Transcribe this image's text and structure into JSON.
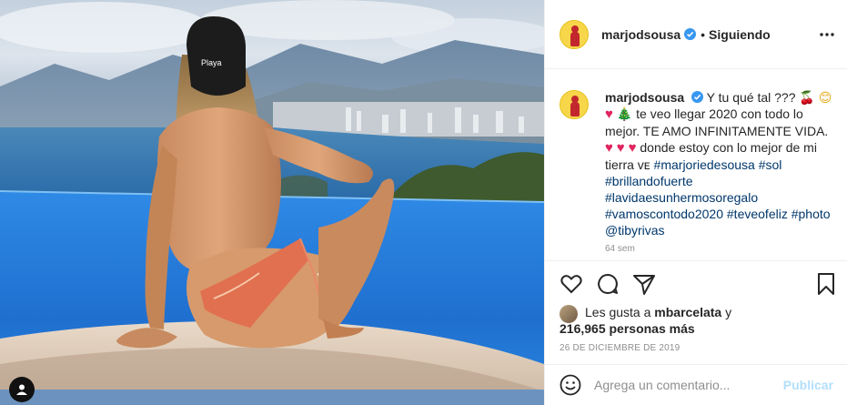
{
  "post": {
    "username": "marjodsousa",
    "follow_status": "Siguiendo",
    "separator": "•"
  },
  "caption": {
    "username": "marjodsousa",
    "line1": "Y tu qué tal ???",
    "line2": "te veo llegar 2020 con todo lo mejor. TE AMO INFINITAMENTE VIDA.",
    "line3": "donde estoy con lo mejor de mi tierra ᴠᴇ",
    "hashtags": [
      "#marjoriedesousa",
      "#sol",
      "#brillandofuerte",
      "#lavidaesunhermosoregalo",
      "#vamoscontodo2020",
      "#teveofeliz",
      "#photo"
    ],
    "mention": "@tibyrivas",
    "ghost_time": "64 sem"
  },
  "likes": {
    "prefix": "Les gusta a",
    "user": "mbarcelata",
    "conj": "y",
    "count_text": "216,965 personas más"
  },
  "date": "26 DE DICIEMBRE DE 2019",
  "comment": {
    "placeholder": "Agrega un comentario...",
    "publish": "Publicar"
  },
  "photo": {
    "cap_text": "Playa"
  },
  "icons": {
    "verified": "verified-badge-icon",
    "more": "more-options-icon",
    "like": "heart-outline-icon",
    "comment": "comment-bubble-icon",
    "share": "paper-plane-icon",
    "save": "bookmark-outline-icon",
    "emoji": "emoji-smile-icon"
  },
  "colors": {
    "link_blue": "#00376b",
    "publish_disabled": "#b2dffc",
    "verified_blue": "#3897f0",
    "pool_blue": "#1e73d6"
  }
}
